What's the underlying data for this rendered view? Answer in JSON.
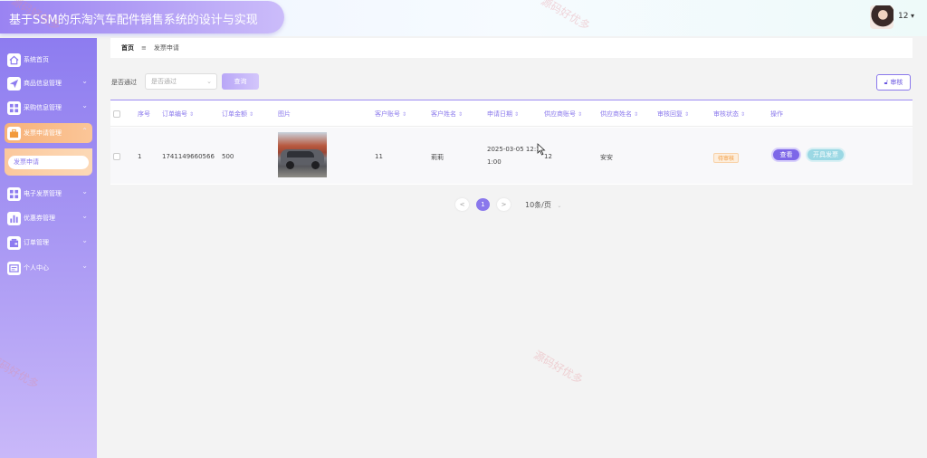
{
  "header": {
    "title": "基于SSM的乐淘汽车配件销售系统的设计与实现",
    "user_name": "12",
    "user_caret": "▾"
  },
  "sidebar": {
    "items": [
      {
        "label": "系统首页",
        "icon": "home-icon"
      },
      {
        "label": "商品信息管理",
        "icon": "send-icon"
      },
      {
        "label": "采购信息管理",
        "icon": "grid-icon"
      },
      {
        "label": "发票申请管理",
        "icon": "briefcase-icon",
        "active": true
      },
      {
        "label": "电子发票管理",
        "icon": "grid-icon"
      },
      {
        "label": "优惠券管理",
        "icon": "bar-chart-icon"
      },
      {
        "label": "订单管理",
        "icon": "wallet-icon"
      },
      {
        "label": "个人中心",
        "icon": "card-icon"
      }
    ],
    "submenu": {
      "label": "发票申请"
    }
  },
  "breadcrumb": {
    "home": "首页",
    "separator": "≡",
    "current": "发票申请"
  },
  "filter": {
    "label": "是否通过",
    "select_placeholder": "是否通过",
    "search_button": "查询",
    "audit_button": "审核"
  },
  "table": {
    "headers": {
      "index": "序号",
      "order_no": "订单编号",
      "amount": "订单金额",
      "image": "图片",
      "customer_account": "客户账号",
      "customer_name": "客户姓名",
      "apply_date": "申请日期",
      "supplier_account": "供应商账号",
      "supplier_name": "供应商姓名",
      "audit_reply": "审核回复",
      "audit_status": "审核状态",
      "actions": "操作"
    },
    "rows": [
      {
        "index": "1",
        "order_no": "1741149660566",
        "amount": "500",
        "customer_account": "11",
        "customer_name": "莉莉",
        "apply_date_line1": "2025-03-05 12:1",
        "apply_date_line2": "1:00",
        "supplier_account": "12",
        "supplier_name": "安安",
        "audit_status": "待审核",
        "view_button": "查看",
        "invoice_button": "开具发票"
      }
    ]
  },
  "pagination": {
    "prev": "<",
    "current_page": "1",
    "next": ">",
    "page_size": "10条/页"
  },
  "watermark": "源码好优多",
  "colors": {
    "accent": "#8a78ec",
    "sidebar_active": "#f7b27a",
    "status_pending": "#f29a3c"
  }
}
